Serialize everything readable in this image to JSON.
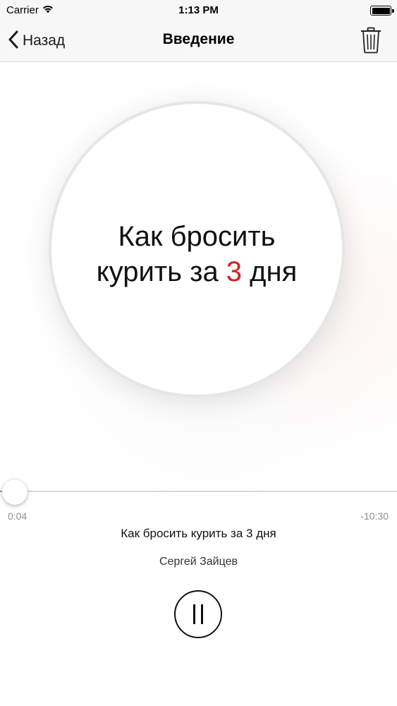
{
  "status_bar": {
    "carrier": "Carrier",
    "time": "1:13 PM"
  },
  "nav": {
    "back_label": "Назад",
    "title": "Введение",
    "back_icon": "chevron-left-icon",
    "trash_icon": "trash-icon"
  },
  "cover": {
    "line1": "Как бросить",
    "line2_before": "курить за ",
    "line2_accent": "3",
    "line2_after": " дня",
    "accent_color": "#d81e1e"
  },
  "player": {
    "progress_fraction": 0.006,
    "elapsed": "0:04",
    "remaining": "-10:30",
    "track_title": "Как бросить курить за 3 дня",
    "author": "Сергей Зайцев",
    "pause_icon": "pause-icon"
  }
}
